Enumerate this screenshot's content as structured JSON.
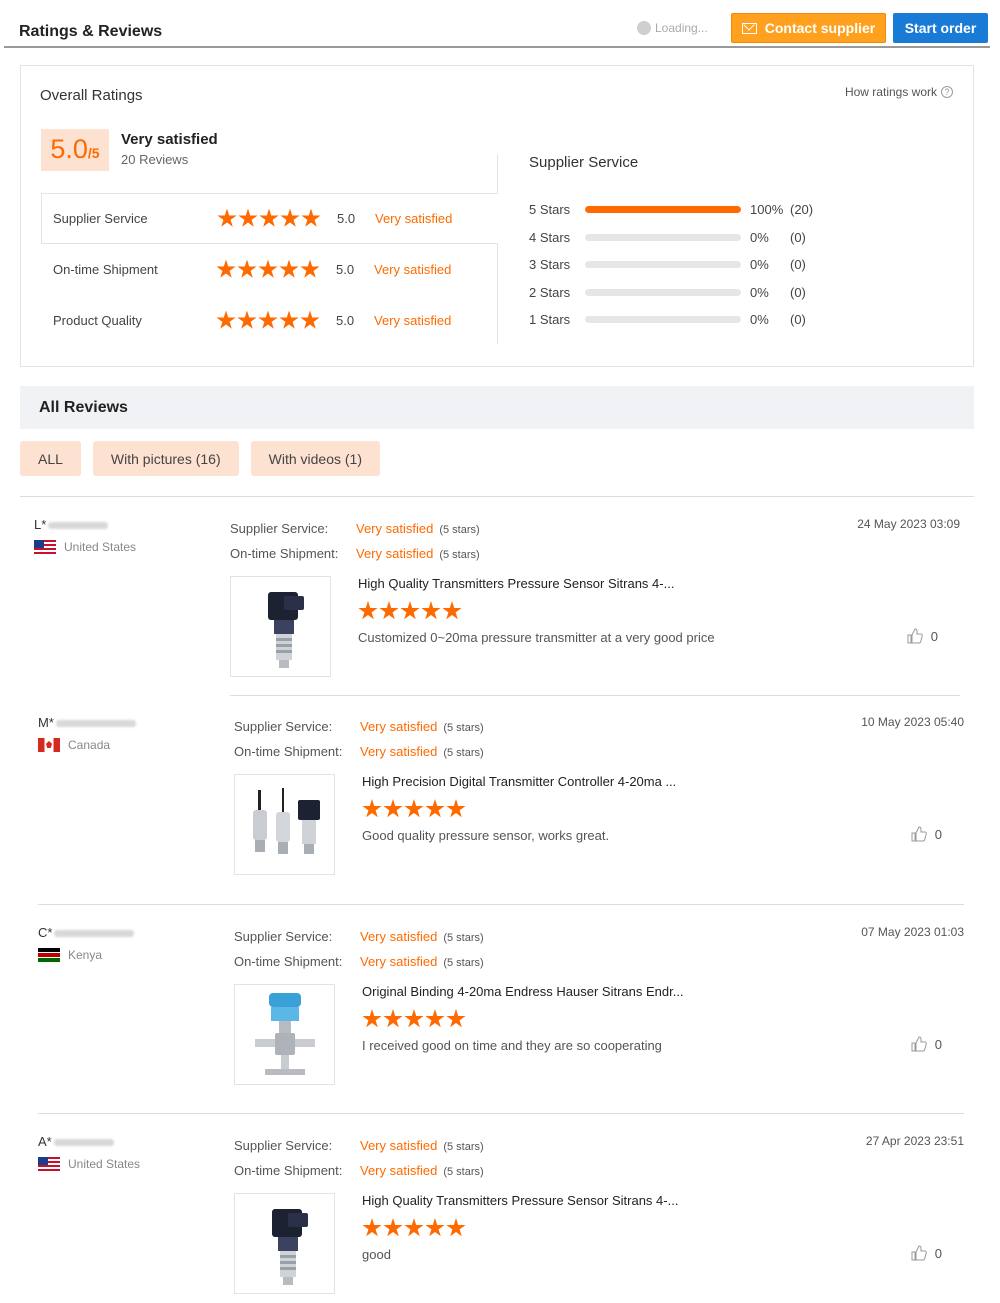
{
  "header": {
    "title": "Ratings & Reviews",
    "loading": "Loading...",
    "contact_label": "Contact supplier",
    "start_label": "Start order"
  },
  "overall": {
    "heading": "Overall Ratings",
    "how_ratings": "How ratings work",
    "score": "5.0",
    "score_max": "/5",
    "satisfaction": "Very satisfied",
    "review_count": "20 Reviews",
    "rows": [
      {
        "label": "Supplier Service",
        "value": "5.0",
        "word": "Very satisfied"
      },
      {
        "label": "On-time Shipment",
        "value": "5.0",
        "word": "Very satisfied"
      },
      {
        "label": "Product Quality",
        "value": "5.0",
        "word": "Very satisfied"
      }
    ]
  },
  "distribution": {
    "title": "Supplier Service",
    "rows": [
      {
        "label": "5  Stars",
        "percent": 100,
        "pct_text": "100%",
        "count": "(20)"
      },
      {
        "label": "4  Stars",
        "percent": 0,
        "pct_text": "0%",
        "count": "(0)"
      },
      {
        "label": "3  Stars",
        "percent": 0,
        "pct_text": "0%",
        "count": "(0)"
      },
      {
        "label": "2  Stars",
        "percent": 0,
        "pct_text": "0%",
        "count": "(0)"
      },
      {
        "label": "1  Stars",
        "percent": 0,
        "pct_text": "0%",
        "count": "(0)"
      }
    ]
  },
  "reviews_section": {
    "title": "All Reviews",
    "filters": [
      "ALL",
      "With pictures (16)",
      "With videos (1)"
    ]
  },
  "labels": {
    "supplier_service": "Supplier Service:",
    "on_time": "On-time Shipment:",
    "very_satisfied": "Very satisfied",
    "five_stars": "(5 stars)"
  },
  "reviews": [
    {
      "user": "L*",
      "country": "United States",
      "flag": "us",
      "date": "24 May 2023 03:09",
      "product": "High Quality Transmitters Pressure Sensor Sitrans 4-...",
      "comment": "Customized 0~20ma pressure transmitter at a very good price",
      "likes": "0",
      "image": "pressure-sensor"
    },
    {
      "user": "M*",
      "country": "Canada",
      "flag": "ca",
      "date": "10 May 2023 05:40",
      "product": "High Precision Digital Transmitter Controller 4-20ma ...",
      "comment": "Good quality pressure sensor, works great.",
      "likes": "0",
      "image": "three-sensors"
    },
    {
      "user": "C*",
      "country": "Kenya",
      "flag": "ke",
      "date": "07 May 2023 01:03",
      "product": "Original Binding 4-20ma Endress Hauser Sitrans Endr...",
      "comment": "I received good on time and they are so cooperating",
      "likes": "0",
      "image": "valve-transmitter"
    },
    {
      "user": "A*",
      "country": "United States",
      "flag": "us",
      "date": "27 Apr 2023 23:51",
      "product": "High Quality Transmitters Pressure Sensor Sitrans 4-...",
      "comment": "good",
      "likes": "0",
      "image": "pressure-sensor"
    }
  ],
  "colors": {
    "accent": "#ff6a00",
    "contact_button": "#ffa01e",
    "start_button": "#1a7bd7",
    "chip_bg": "#fde1d1"
  }
}
